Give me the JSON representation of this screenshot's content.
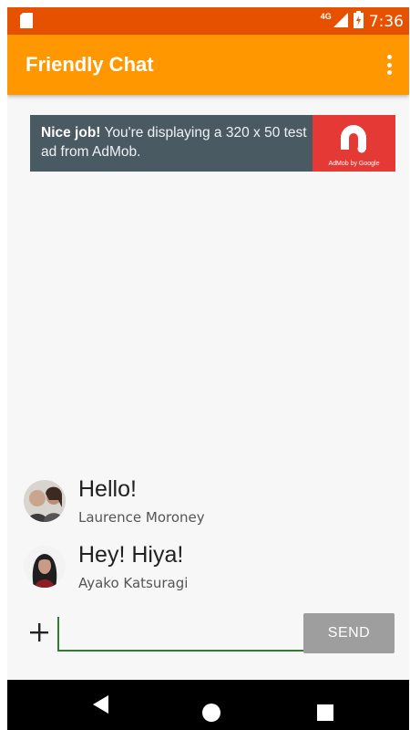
{
  "status_bar": {
    "network": "4G",
    "time": "7:36"
  },
  "app_bar": {
    "title": "Friendly Chat",
    "menu_icon": "more-vert-icon"
  },
  "ad": {
    "bold_text": "Nice job!",
    "text": " You're displaying a 320 x 50 test ad from AdMob.",
    "logo_caption": "AdMob by Google"
  },
  "messages": [
    {
      "text": "Hello!",
      "author": "Laurence Moroney"
    },
    {
      "text": "Hey! Hiya!",
      "author": "Ayako Katsuragi"
    }
  ],
  "composer": {
    "add_icon": "plus-icon",
    "input_value": "",
    "send_label": "SEND"
  },
  "colors": {
    "status_bar": "#e65100",
    "app_bar": "#ff9800",
    "ad_logo": "#e53935",
    "input_underline": "#2e7d32",
    "send_button": "#9e9e9e"
  },
  "nav_bar": {
    "icons": [
      "back-icon",
      "home-icon",
      "recents-icon"
    ]
  }
}
